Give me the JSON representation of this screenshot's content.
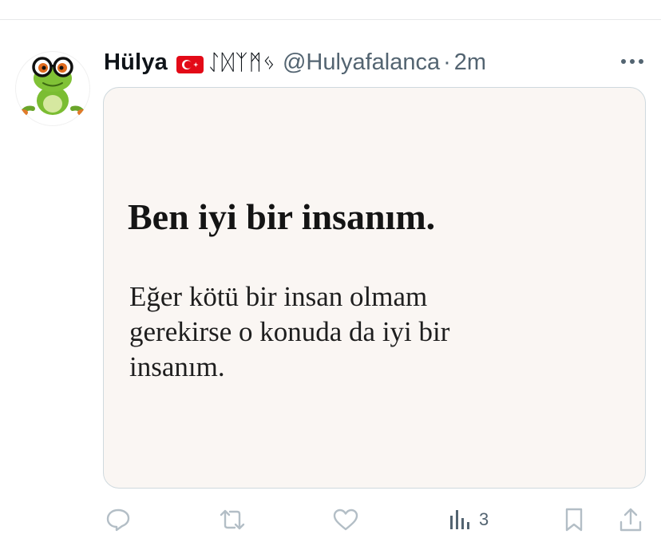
{
  "tweet": {
    "author": {
      "display_name": "Hülya",
      "flag_icon": "turkey-flag-icon",
      "runic_text": "ᛇᛞᛉᛗᛃ",
      "handle": "@Hulyafalanca",
      "separator": "·",
      "time": "2m",
      "avatar_icon": "frog-with-glasses-avatar"
    },
    "media": {
      "title": "Ben iyi bir insanım.",
      "body_lines": [
        "Eğer kötü bir insan olmam",
        "gerekirse o konuda da iyi bir",
        "insanım."
      ]
    },
    "actions": {
      "reply_icon": "reply-icon",
      "retweet_icon": "retweet-icon",
      "like_icon": "like-icon",
      "views_icon": "views-icon",
      "views_count": "3",
      "bookmark_icon": "bookmark-icon",
      "share_icon": "share-icon"
    }
  },
  "colors": {
    "text_primary": "#0f1419",
    "text_secondary": "#536471",
    "icon_muted": "#b3bec6",
    "card_background": "#faf6f3",
    "border": "#cfd9de",
    "flag_red": "#e30a17"
  }
}
